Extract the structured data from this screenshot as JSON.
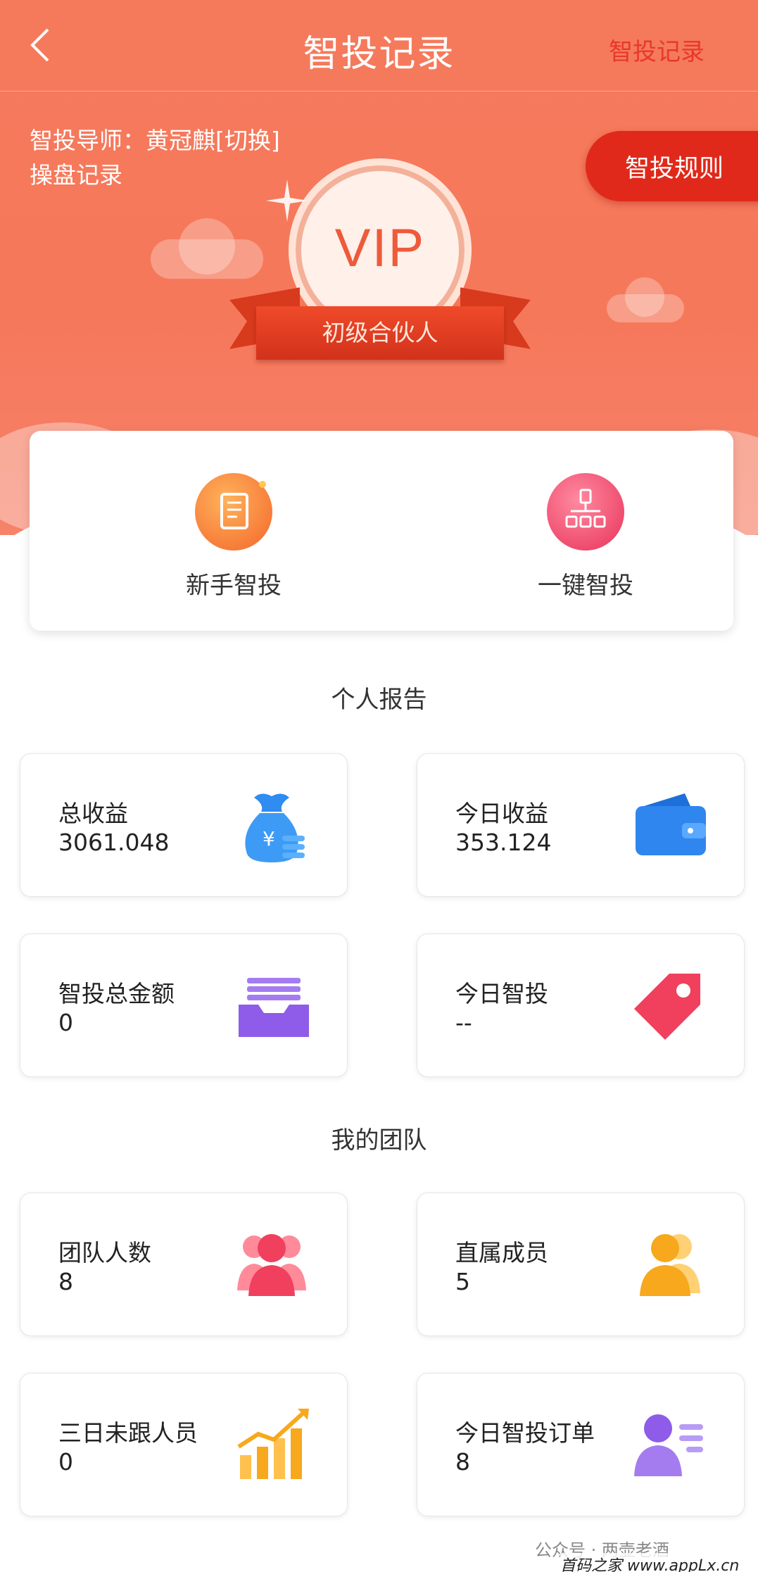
{
  "header": {
    "title": "智投记录",
    "right_link": "智投记录"
  },
  "hero": {
    "mentor_text": "智投导师：黄冠麒[切换]",
    "records_link": "操盘记录",
    "rules_button": "智投规则",
    "vip_badge": "VIP",
    "vip_level": "初级合伙人"
  },
  "quick_actions": [
    {
      "label": "新手智投",
      "icon": "notebook-icon"
    },
    {
      "label": "一键智投",
      "icon": "org-chart-icon"
    }
  ],
  "personal_report": {
    "title": "个人报告",
    "cards": [
      {
        "label": "总收益",
        "value": "3061.048",
        "icon": "money-bag-icon"
      },
      {
        "label": "今日收益",
        "value": "353.124",
        "icon": "wallet-icon"
      },
      {
        "label": "智投总金额",
        "value": "0",
        "icon": "inbox-tray-icon"
      },
      {
        "label": "今日智投",
        "value": "--",
        "icon": "tag-icon"
      }
    ]
  },
  "my_team": {
    "title": "我的团队",
    "cards": [
      {
        "label": "团队人数",
        "value": "8",
        "icon": "group-icon"
      },
      {
        "label": "直属成员",
        "value": "5",
        "icon": "members-icon"
      },
      {
        "label": "三日未跟人员",
        "value": "0",
        "icon": "growth-chart-icon"
      },
      {
        "label": "今日智投订单",
        "value": "8",
        "icon": "user-card-icon"
      }
    ]
  },
  "watermark": {
    "text": "公众号 · 两壶老酒",
    "site": "首码之家 www.appLx.cn"
  },
  "colors": {
    "hero": "#f57a5c",
    "accent_red": "#e0291a",
    "nav_link": "#e8382a"
  }
}
